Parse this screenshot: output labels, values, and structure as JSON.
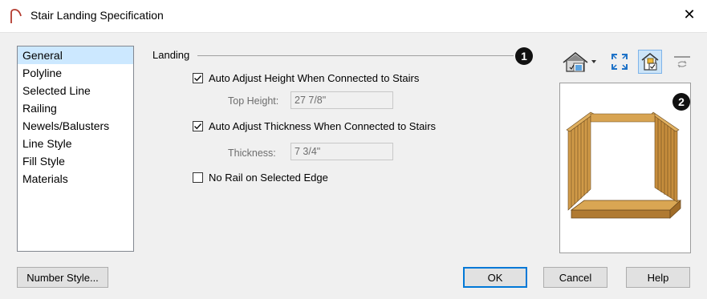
{
  "window": {
    "title": "Stair Landing Specification",
    "close_glyph": "✕"
  },
  "panels": [
    {
      "label": "General",
      "selected": true
    },
    {
      "label": "Polyline"
    },
    {
      "label": "Selected Line"
    },
    {
      "label": "Railing"
    },
    {
      "label": "Newels/Balusters"
    },
    {
      "label": "Line Style"
    },
    {
      "label": "Fill Style"
    },
    {
      "label": "Materials"
    }
  ],
  "landing": {
    "group_label": "Landing",
    "auto_height": {
      "label": "Auto Adjust Height When Connected to Stairs",
      "checked": true
    },
    "top_height": {
      "label": "Top Height:",
      "value": "27 7/8\""
    },
    "auto_thickness": {
      "label": "Auto Adjust Thickness When Connected to Stairs",
      "checked": true
    },
    "thickness": {
      "label": "Thickness:",
      "value": "7 3/4\""
    },
    "no_rail": {
      "label": "No Rail on Selected Edge",
      "checked": false
    }
  },
  "callouts": {
    "one": "1",
    "two": "2"
  },
  "toolbar": {
    "icons": [
      "view-3d-dropdown-icon",
      "fill-window-icon",
      "show-selected-icon",
      "swap-icon"
    ]
  },
  "footer": {
    "number_style": "Number Style...",
    "ok": "OK",
    "cancel": "Cancel",
    "help": "Help"
  },
  "colors": {
    "selection": "#cce8ff",
    "accent": "#0078d7",
    "wood": "#c9913f"
  }
}
